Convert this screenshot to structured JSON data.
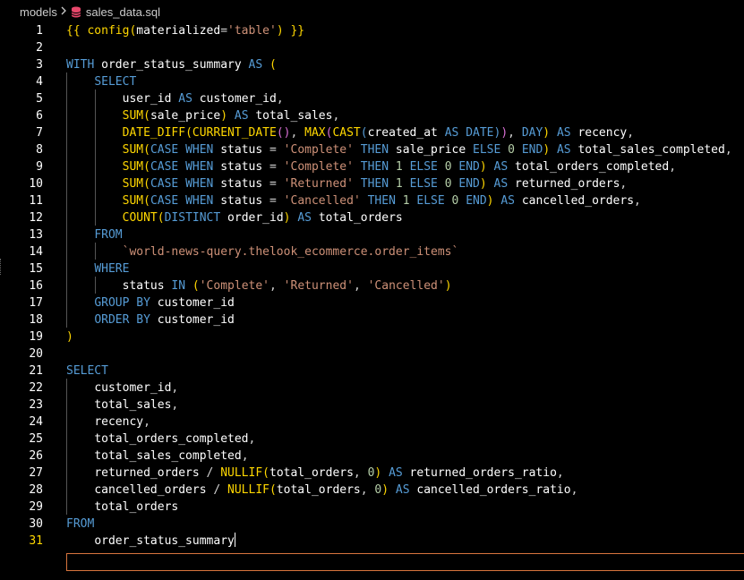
{
  "breadcrumb": {
    "folder": "models",
    "file": "sales_data.sql"
  },
  "editor": {
    "active_line": 31,
    "lines": [
      "{{ config(materialized='table') }}",
      "",
      "WITH order_status_summary AS (",
      "    SELECT",
      "        user_id AS customer_id,",
      "        SUM(sale_price) AS total_sales,",
      "        DATE_DIFF(CURRENT_DATE(), MAX(CAST(created_at AS DATE)), DAY) AS recency,",
      "        SUM(CASE WHEN status = 'Complete' THEN sale_price ELSE 0 END) AS total_sales_completed,",
      "        SUM(CASE WHEN status = 'Complete' THEN 1 ELSE 0 END) AS total_orders_completed,",
      "        SUM(CASE WHEN status = 'Returned' THEN 1 ELSE 0 END) AS returned_orders,",
      "        SUM(CASE WHEN status = 'Cancelled' THEN 1 ELSE 0 END) AS cancelled_orders,",
      "        COUNT(DISTINCT order_id) AS total_orders",
      "    FROM",
      "        `world-news-query.thelook_ecommerce.order_items`",
      "    WHERE",
      "        status IN ('Complete', 'Returned', 'Cancelled')",
      "    GROUP BY customer_id",
      "    ORDER BY customer_id",
      ")",
      "",
      "SELECT",
      "    customer_id,",
      "    total_sales,",
      "    recency,",
      "    total_orders_completed,",
      "    total_sales_completed,",
      "    returned_orders / NULLIF(total_orders, 0) AS returned_orders_ratio,",
      "    cancelled_orders / NULLIF(total_orders, 0) AS cancelled_orders_ratio,",
      "    total_orders",
      "FROM",
      "    order_status_summary"
    ]
  },
  "colors": {
    "keyword": "#569cd6",
    "function": "#ffd700",
    "string": "#ce9178",
    "number": "#b5cea8",
    "active_line_border": "#d7743d"
  },
  "icons": {
    "file_icon": "database-icon",
    "separator": "chevron-right-icon"
  }
}
